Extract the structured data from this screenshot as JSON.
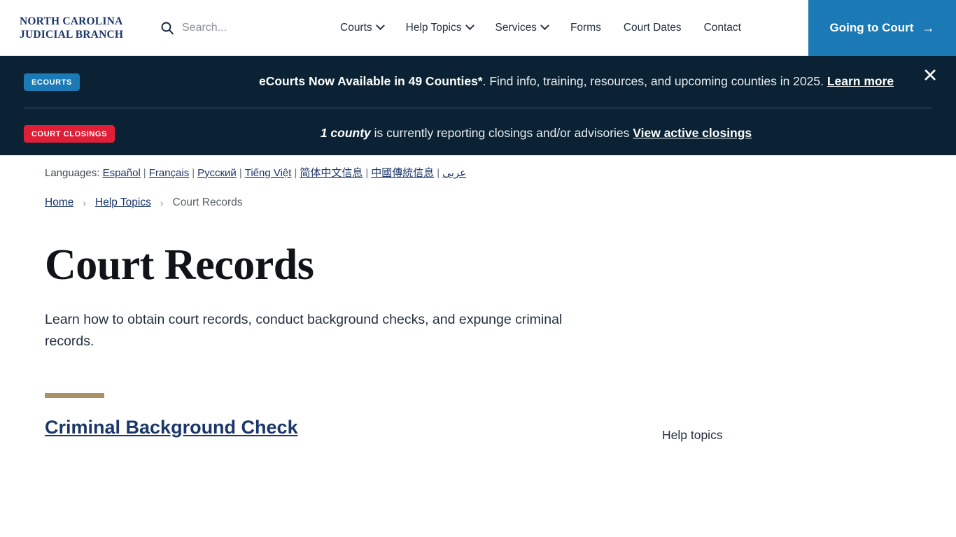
{
  "header": {
    "logo_line1": "NORTH CAROLINA",
    "logo_line2": "JUDICIAL BRANCH",
    "search": {
      "icon": "search-icon",
      "placeholder": "Search...",
      "value": ""
    },
    "nav": [
      {
        "label": "Courts",
        "has_dropdown": true
      },
      {
        "label": "Help Topics",
        "has_dropdown": true
      },
      {
        "label": "Services",
        "has_dropdown": true
      },
      {
        "label": "Forms",
        "has_dropdown": false
      },
      {
        "label": "Court Dates",
        "has_dropdown": false
      },
      {
        "label": "Contact",
        "has_dropdown": false
      }
    ],
    "cta": {
      "label": "Going to Court",
      "arrow": "→",
      "background": "#1b7ab5"
    }
  },
  "alerts": {
    "background": "#0a2233",
    "close_label": "✕",
    "ecourts": {
      "badge": "ECOURTS",
      "badge_color": "#1b7ab5",
      "headline": "eCourts Now Available in 49 Counties*",
      "body": ". Find info, training, resources, and upcoming counties in 2025. ",
      "link": "Learn more"
    },
    "closings": {
      "badge": "COURT CLOSINGS",
      "badge_color": "#e01f37",
      "count": "1 county",
      "body": " is currently reporting closings and/or advisories ",
      "link": "View active closings"
    }
  },
  "languages": {
    "label": "Languages:",
    "separator": "|",
    "items": [
      "Español",
      "Français",
      "Русский",
      "Tiếng Việt",
      "简体中文信息",
      "中國傳統信息",
      "عربى"
    ]
  },
  "breadcrumb": {
    "separator": "›",
    "items": [
      {
        "label": "Home",
        "current": false
      },
      {
        "label": "Help Topics",
        "current": false
      },
      {
        "label": "Court Records",
        "current": true
      }
    ]
  },
  "page": {
    "title": "Court Records",
    "description": "Learn how to obtain court records, conduct background checks, and expunge criminal records.",
    "accent_color": "#ab9169",
    "section_link": "Criminal Background Check",
    "sidebar_title": "Help topics"
  }
}
